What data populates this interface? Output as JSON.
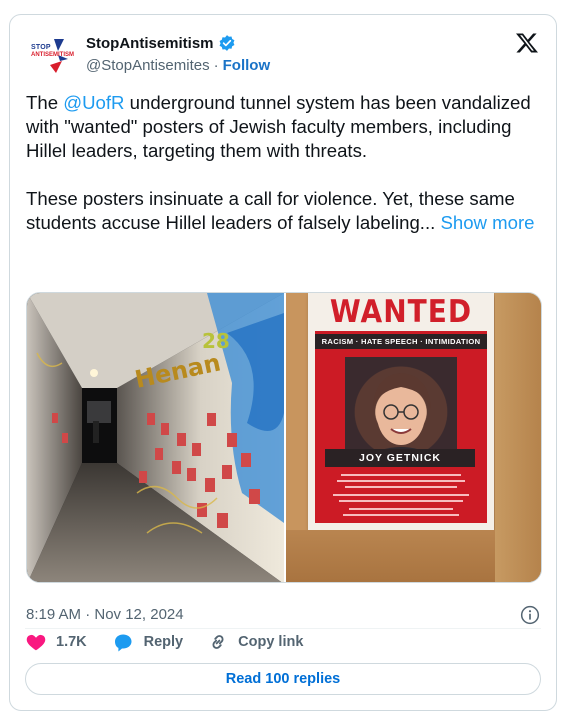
{
  "tweet": {
    "author": {
      "display_name": "StopAntisemitism",
      "handle": "@StopAntisemites",
      "separator": "·",
      "follow_label": "Follow",
      "avatar_text_top": "STOP",
      "avatar_text_bottom": "ANTISEMITISM",
      "verified": true
    },
    "text": {
      "p1_before": "The ",
      "p1_mention": "@UofR",
      "p1_after": " underground tunnel system has been vandalized with \"wanted\" posters of Jewish faculty members, including Hillel leaders, targeting them with threats.",
      "p2": "These posters insinuate a call for violence. Yet, these same students accuse Hillel leaders of falsely labeling... ",
      "show_more": "Show more"
    },
    "media": {
      "left_image": "tunnel-photo",
      "right_image": {
        "poster_title": "WANTED",
        "poster_banner": "RACISM · HATE SPEECH · INTIMIDATION",
        "poster_name": "JOY GETNICK"
      }
    },
    "timestamp": "8:19 AM · Nov 12, 2024",
    "actions": {
      "like_count": "1.7K",
      "reply_label": "Reply",
      "copy_label": "Copy link"
    },
    "read_replies_label": "Read 100 replies"
  },
  "colors": {
    "accent": "#1d9bf0",
    "like": "#f91880",
    "muted": "#536471",
    "border": "#cfd9de"
  }
}
